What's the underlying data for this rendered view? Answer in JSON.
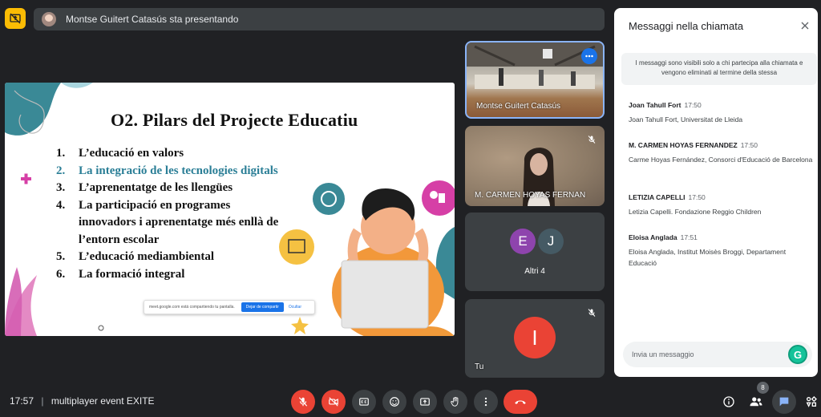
{
  "presenter_bar": {
    "text": "Montse Guitert Catasús sta presentando"
  },
  "slide": {
    "title": "O2. Pilars del Projecte Educatiu",
    "items": [
      {
        "num": "1.",
        "text": "L’educació en valors"
      },
      {
        "num": "2.",
        "text": "La integració de les tecnologies digitals"
      },
      {
        "num": "3.",
        "text": "L’aprenentatge de les llengües"
      },
      {
        "num": "4.",
        "text": "La participació en programes"
      },
      {
        "num": "",
        "text": "innovadors i aprenentatge més enllà de"
      },
      {
        "num": "",
        "text": "l’entorn escolar"
      },
      {
        "num": "5.",
        "text": "L’educació mediambiental"
      },
      {
        "num": "6.",
        "text": "La formació integral"
      }
    ],
    "share_bar": {
      "text": "meet.google.com está compartiendo tu pantalla.",
      "stop_label": "Dejar de compartir",
      "hide_label": "Ocultar"
    }
  },
  "tiles": [
    {
      "label": "Montse Guitert Catasús"
    },
    {
      "label": "M. CARMEN HOYAS FERNAN"
    },
    {
      "initial_1": "E",
      "initial_2": "J",
      "label": "Altri 4"
    },
    {
      "initial": "I",
      "label": "Tu"
    }
  ],
  "chat": {
    "title": "Messaggi nella chiamata",
    "notice": "I messaggi sono visibili solo a chi partecipa alla chiamata e vengono eliminati al termine della stessa",
    "messages": [
      {
        "sender": "Joan Tahull Fort",
        "time": "17:50",
        "text": "Joan Tahull Fort,  Universitat de Lleida"
      },
      {
        "sender": "M. CARMEN HOYAS FERNANDEZ",
        "time": "17:50",
        "text": "Carme Hoyas Fernández, Consorci d'Educació de Barcelona"
      },
      {
        "sender": "LETIZIA CAPELLI",
        "time": "17:50",
        "text": "Letizia Capelli. Fondazione Reggio Children"
      },
      {
        "sender": "Eloisa Anglada",
        "time": "17:51",
        "text": "Eloisa Anglada, Institut Moisès Broggi, Departament Educació"
      }
    ],
    "input_placeholder": "Invia un messaggio",
    "grammarly_letter": "G"
  },
  "bottom_bar": {
    "time": "17:57",
    "separator": "|",
    "meeting_name": "multiplayer event EXITE",
    "people_count": "8"
  },
  "colors": {
    "background": "#202124",
    "danger": "#ea4335",
    "accent": "#1a73e8",
    "present_badge": "#fbbc04"
  },
  "icons": {
    "present_badge": "present-to-all-off-icon",
    "mic": "mic-off-icon",
    "camera": "videocam-off-icon",
    "captions": "closed-caption-icon",
    "emoji": "emoji-icon",
    "present": "present-now-icon",
    "hand": "raise-hand-icon",
    "more": "more-vert-icon",
    "hangup": "call-end-icon",
    "info": "info-icon",
    "people": "people-icon",
    "chat": "chat-icon",
    "activities": "activities-icon"
  }
}
